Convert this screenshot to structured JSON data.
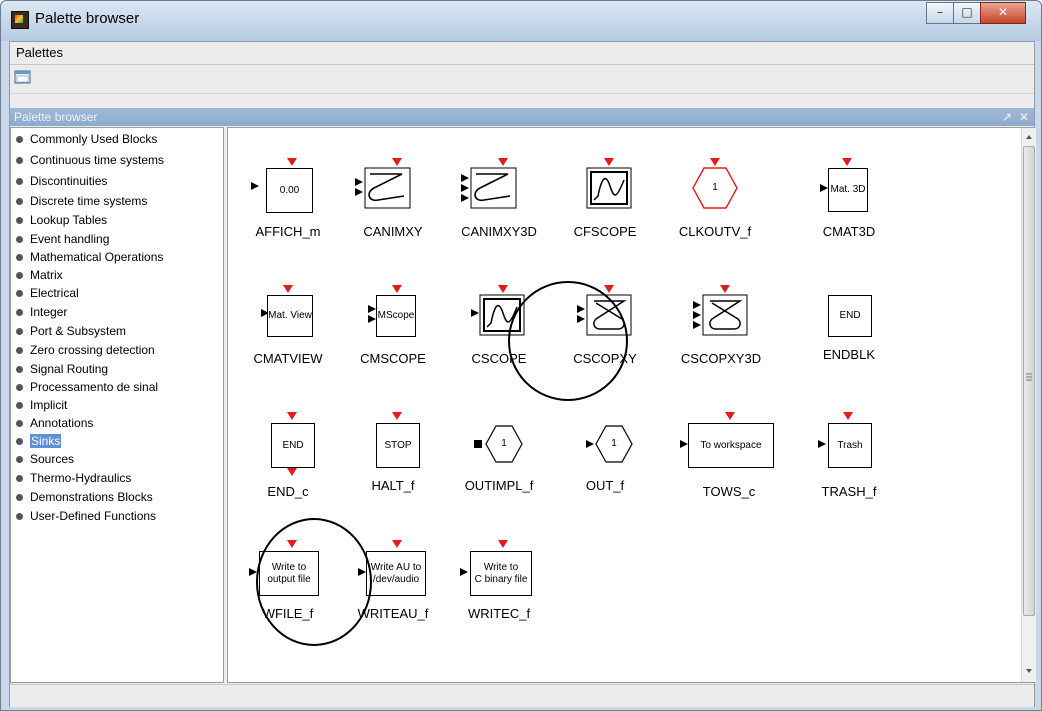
{
  "window": {
    "title": "Palette browser"
  },
  "menubar": {
    "palettes_label": "Palettes"
  },
  "panel": {
    "title": "Palette browser",
    "maximize_glyph": "↗",
    "close_glyph": "✕"
  },
  "tree": {
    "items": [
      {
        "label": "Commonly Used Blocks"
      },
      {
        "label": "Continuous time systems"
      },
      {
        "label": "Discontinuities"
      },
      {
        "label": "Discrete time systems"
      },
      {
        "label": "Lookup Tables"
      },
      {
        "label": "Event handling"
      },
      {
        "label": "Mathematical Operations"
      },
      {
        "label": "Matrix"
      },
      {
        "label": "Electrical"
      },
      {
        "label": "Integer"
      },
      {
        "label": "Port & Subsystem"
      },
      {
        "label": "Zero crossing detection"
      },
      {
        "label": "Signal Routing"
      },
      {
        "label": "Processamento de sinal"
      },
      {
        "label": "Implicit"
      },
      {
        "label": "Annotations"
      },
      {
        "label": "Sinks",
        "selected": true
      },
      {
        "label": "Sources"
      },
      {
        "label": "Thermo-Hydraulics"
      },
      {
        "label": "Demonstrations Blocks"
      },
      {
        "label": "User-Defined Functions"
      }
    ]
  },
  "blocks": [
    {
      "name": "AFFICH_m",
      "text": "0.00"
    },
    {
      "name": "CANIMXY",
      "icon": "lissajous-icon"
    },
    {
      "name": "CANIMXY3D",
      "icon": "lissajous-icon"
    },
    {
      "name": "CFSCOPE",
      "icon": "scope-icon"
    },
    {
      "name": "CLKOUTV_f",
      "text": "1",
      "icon": "hexagon-icon"
    },
    {
      "name": "CMAT3D",
      "text": "Mat. 3D"
    },
    {
      "name": "CMATVIEW",
      "text": "Mat. View"
    },
    {
      "name": "CMSCOPE",
      "text": "MScope"
    },
    {
      "name": "CSCOPE",
      "icon": "scope-icon",
      "highlighted": true
    },
    {
      "name": "CSCOPXY",
      "icon": "figure-eight-icon"
    },
    {
      "name": "CSCOPXY3D",
      "icon": "figure-eight-icon"
    },
    {
      "name": "ENDBLK",
      "text": "END"
    },
    {
      "name": "END_c",
      "text": "END"
    },
    {
      "name": "HALT_f",
      "text": "STOP"
    },
    {
      "name": "OUTIMPL_f",
      "text": "1",
      "icon": "hexagon-icon"
    },
    {
      "name": "OUT_f",
      "text": "1",
      "icon": "hexagon-icon"
    },
    {
      "name": "TOWS_c",
      "text": "To workspace"
    },
    {
      "name": "TRASH_f",
      "text": "Trash"
    },
    {
      "name": "WFILE_f",
      "text_lines": [
        "Write to",
        "output file"
      ],
      "highlighted": true
    },
    {
      "name": "WRITEAU_f",
      "text_lines": [
        "Write AU to",
        "/dev/audio"
      ]
    },
    {
      "name": "WRITEC_f",
      "text_lines": [
        "Write to",
        "C binary file"
      ]
    }
  ],
  "colors": {
    "port_event": "#e31b1b",
    "port_input": "#000000",
    "clock_hexagon": "#e31b1b",
    "selection": "#5c8fd6"
  }
}
